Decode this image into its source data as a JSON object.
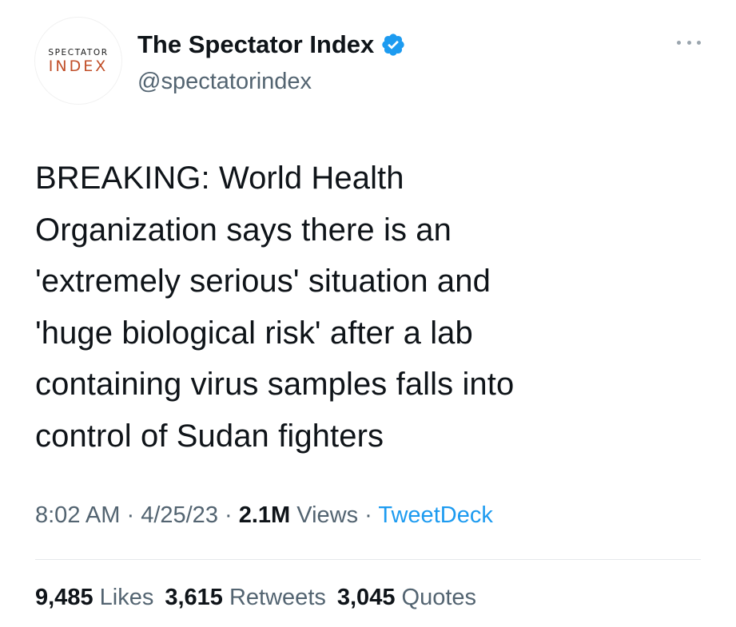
{
  "author": {
    "avatar": {
      "line1": "SPECTATOR",
      "line2": "INDEX",
      "line1_color": "#1a1a1a",
      "line2_color": "#c1502a"
    },
    "display_name": "The Spectator Index",
    "handle": "@spectatorindex",
    "verified_icon": "verified-badge-icon",
    "verified_color": "#1d9bf0"
  },
  "menu": {
    "icon": "more-options-icon"
  },
  "tweet": {
    "text": "BREAKING: World Health\nOrganization says there is an\n'extremely serious' situation and\n'huge biological risk' after a lab\ncontaining virus samples falls into\ncontrol of Sudan fighters"
  },
  "meta": {
    "time": "8:02 AM",
    "date": "4/25/23",
    "separator": " · ",
    "views_count": "2.1M",
    "views_label": "Views",
    "source": "TweetDeck",
    "source_color": "#1d9bf0"
  },
  "stats": {
    "likes_count": "9,485",
    "likes_label": "Likes",
    "retweets_count": "3,615",
    "retweets_label": "Retweets",
    "quotes_count": "3,045",
    "quotes_label": "Quotes"
  }
}
